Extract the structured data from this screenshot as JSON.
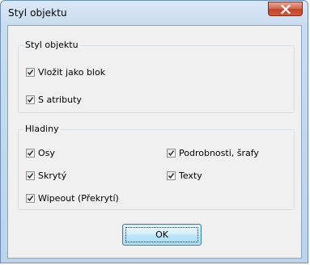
{
  "window": {
    "title": "Styl objektu",
    "close_icon": "close-icon"
  },
  "groups": {
    "style": {
      "label": "Styl objektu",
      "items": [
        {
          "label": "Vložit jako blok",
          "checked": true
        },
        {
          "label": "S atributy",
          "checked": true
        }
      ]
    },
    "layers": {
      "label": "Hladiny",
      "items": [
        {
          "label": "Osy",
          "checked": true
        },
        {
          "label": "Skrytý",
          "checked": true
        },
        {
          "label": "Wipeout (Překrytí)",
          "checked": true
        },
        {
          "label": "Podrobnosti, šrafy",
          "checked": true
        },
        {
          "label": "Texty",
          "checked": true
        }
      ]
    }
  },
  "buttons": {
    "ok_label": "OK"
  },
  "colors": {
    "title_gradient_top": "#dbe8f6",
    "close_button": "#c2432a",
    "client_bg": "#f0f0f0",
    "ok_button_border": "#3c7fb1"
  }
}
